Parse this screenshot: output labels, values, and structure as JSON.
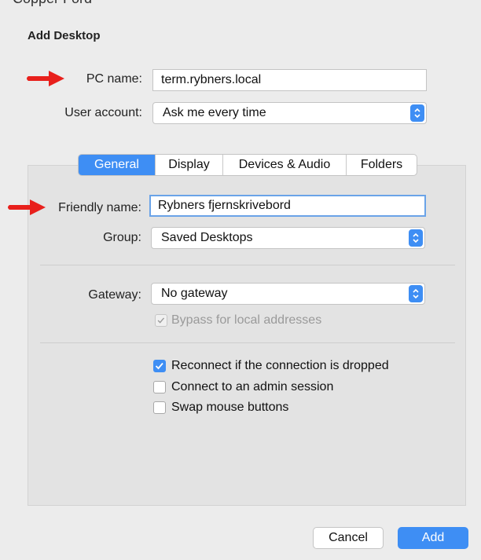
{
  "cut_text": "Copper Ford",
  "dialog": {
    "title": "Add Desktop",
    "pc_name_label": "PC name:",
    "pc_name_value": "term.rybners.local",
    "user_account_label": "User account:",
    "user_account_value": "Ask me every time"
  },
  "tabs": [
    {
      "label": "General"
    },
    {
      "label": "Display"
    },
    {
      "label": "Devices & Audio"
    },
    {
      "label": "Folders"
    }
  ],
  "general": {
    "friendly_name_label": "Friendly name:",
    "friendly_name_value": "Rybners fjernskrivebord",
    "group_label": "Group:",
    "group_value": "Saved Desktops",
    "gateway_label": "Gateway:",
    "gateway_value": "No gateway",
    "bypass_label": "Bypass for local addresses",
    "reconnect_label": "Reconnect if the connection is dropped",
    "admin_label": "Connect to an admin session",
    "swap_label": "Swap mouse buttons"
  },
  "checkbox_states": {
    "bypass": true,
    "reconnect": true,
    "admin": false,
    "swap": false
  },
  "buttons": {
    "cancel": "Cancel",
    "add": "Add"
  },
  "colors": {
    "accent": "#3e8ef4",
    "arrow": "#e8201c",
    "window": "#ececec",
    "panel": "#e3e3e3"
  }
}
